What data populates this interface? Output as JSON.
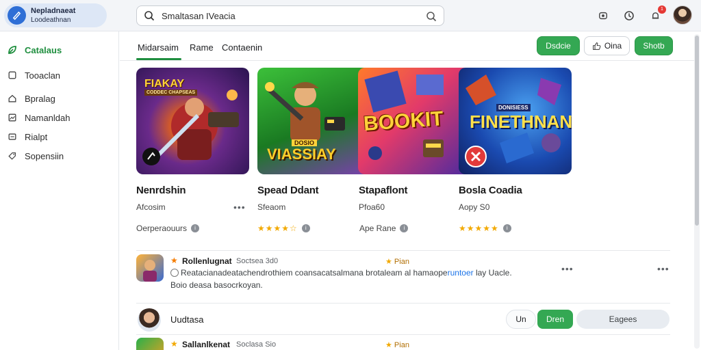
{
  "brand": {
    "line1": "Nepladnaeat",
    "line2": "Loodeathnan"
  },
  "search": {
    "value": "Smaltasan IVeacia"
  },
  "notifications": {
    "badge": "1"
  },
  "sidebar": {
    "items": [
      {
        "label": "Catalaus",
        "icon": "leaf-icon",
        "active": true
      },
      {
        "label": "Tooaclan",
        "icon": "square-icon",
        "active": false
      },
      {
        "label": "Bpralag",
        "icon": "home-icon",
        "active": false
      },
      {
        "label": "Namanldah",
        "icon": "image-icon",
        "active": false
      },
      {
        "label": "Rialpt",
        "icon": "box-icon",
        "active": false
      },
      {
        "label": "Sopensiin",
        "icon": "tag-icon",
        "active": false
      }
    ]
  },
  "tabs": [
    {
      "label": "Midarsaim",
      "active": true
    },
    {
      "label": "Rame",
      "active": false
    },
    {
      "label": "Contaenin",
      "active": false
    }
  ],
  "actions": {
    "btn1": "Dsdcie",
    "btn2": "Oina",
    "btn3": "Shotb"
  },
  "cards": [
    {
      "title": "Nenrdshin",
      "sub": "Afcosim",
      "meta": "Oerperaouurs",
      "art_line1": "FIAKAY",
      "art_line2": "CODDEC CHAPSEAS",
      "rating": null
    },
    {
      "title": "Spead Ddant",
      "sub": "Sfeaom",
      "meta": "",
      "art_line1": "DOSIO",
      "art_line2": "VIASSIAY",
      "rating": 4
    },
    {
      "title": "Stapaflont",
      "sub": "Pfoa60",
      "meta": "Ape Rane",
      "art_line1": "BOOKIT",
      "art_line2": "",
      "rating": null
    },
    {
      "title": "Bosla Coadia",
      "sub": "Aopy S0",
      "meta": "",
      "art_line1": "FINETHNAN",
      "art_line2": "DONISIESS",
      "rating": 4.5
    }
  ],
  "reviews": [
    {
      "name": "Rollenlugnat",
      "meta": "Soctsea 3d0",
      "rating": "Pian",
      "body1_a": "Reatacianadeatachendrothiem coansacatsalmana brotaleam al hamaope",
      "body1_link": "runtoer",
      "body1_b": "lay Uacle.",
      "body2": "Boio deasa basocrkoyan."
    },
    {
      "name": "Uudtasa",
      "btn_un": "Un",
      "btn_green": "Dren",
      "btn_gray": "Eagees"
    },
    {
      "name": "Sallanlkenat",
      "meta": "Soclasa Sio",
      "rating": "Pian"
    }
  ]
}
